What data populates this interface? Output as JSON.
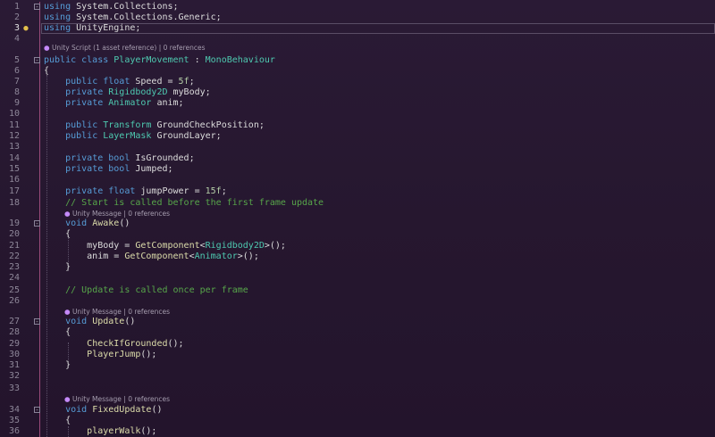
{
  "lens": {
    "unity_script": "Unity Script (1 asset reference) | 0 references",
    "unity_message": "Unity Message | 0 references"
  },
  "lines": [
    {
      "n": "1",
      "tokens": [
        [
          "kw",
          "using"
        ],
        [
          "ident",
          " System.Collections;"
        ]
      ]
    },
    {
      "n": "2",
      "tokens": [
        [
          "kw",
          "using"
        ],
        [
          "ident",
          " System.Collections.Generic;"
        ]
      ]
    },
    {
      "n": "3",
      "tokens": [
        [
          "kw",
          "using"
        ],
        [
          "ident",
          " UnityEngine;"
        ]
      ]
    },
    {
      "n": "4",
      "tokens": []
    },
    {
      "n": "5",
      "tokens": [
        [
          "kw",
          "public class "
        ],
        [
          "typ",
          "PlayerMovement"
        ],
        [
          "ident",
          " : "
        ],
        [
          "typ",
          "MonoBehaviour"
        ]
      ]
    },
    {
      "n": "6",
      "tokens": [
        [
          "ident",
          "{"
        ]
      ]
    },
    {
      "n": "7",
      "tokens": [
        [
          "ident",
          "    "
        ],
        [
          "kw",
          "public float "
        ],
        [
          "ident",
          "Speed = "
        ],
        [
          "num-lit",
          "5f"
        ],
        [
          "ident",
          ";"
        ]
      ]
    },
    {
      "n": "8",
      "tokens": [
        [
          "ident",
          "    "
        ],
        [
          "kw",
          "private "
        ],
        [
          "typ",
          "Rigidbody2D"
        ],
        [
          "ident",
          " myBody;"
        ]
      ]
    },
    {
      "n": "9",
      "tokens": [
        [
          "ident",
          "    "
        ],
        [
          "kw",
          "private "
        ],
        [
          "typ",
          "Animator"
        ],
        [
          "ident",
          " anim;"
        ]
      ]
    },
    {
      "n": "10",
      "tokens": []
    },
    {
      "n": "11",
      "tokens": [
        [
          "ident",
          "    "
        ],
        [
          "kw",
          "public "
        ],
        [
          "typ",
          "Transform"
        ],
        [
          "ident",
          " GroundCheckPosition;"
        ]
      ]
    },
    {
      "n": "12",
      "tokens": [
        [
          "ident",
          "    "
        ],
        [
          "kw",
          "public "
        ],
        [
          "typ",
          "LayerMask"
        ],
        [
          "ident",
          " GroundLayer;"
        ]
      ]
    },
    {
      "n": "13",
      "tokens": []
    },
    {
      "n": "14",
      "tokens": [
        [
          "ident",
          "    "
        ],
        [
          "kw",
          "private bool "
        ],
        [
          "ident",
          "IsGrounded;"
        ]
      ]
    },
    {
      "n": "15",
      "tokens": [
        [
          "ident",
          "    "
        ],
        [
          "kw",
          "private bool "
        ],
        [
          "ident",
          "Jumped;"
        ]
      ]
    },
    {
      "n": "16",
      "tokens": []
    },
    {
      "n": "17",
      "tokens": [
        [
          "ident",
          "    "
        ],
        [
          "kw",
          "private float "
        ],
        [
          "ident",
          "jumpPower = "
        ],
        [
          "num-lit",
          "15f"
        ],
        [
          "ident",
          ";"
        ]
      ]
    },
    {
      "n": "18",
      "tokens": [
        [
          "ident",
          "    "
        ],
        [
          "cmt",
          "// Start is called before the first frame update"
        ]
      ]
    },
    {
      "n": "19",
      "tokens": [
        [
          "ident",
          "    "
        ],
        [
          "kw",
          "void "
        ],
        [
          "method",
          "Awake"
        ],
        [
          "ident",
          "()"
        ]
      ]
    },
    {
      "n": "20",
      "tokens": [
        [
          "ident",
          "    {"
        ]
      ]
    },
    {
      "n": "21",
      "tokens": [
        [
          "ident",
          "        myBody = "
        ],
        [
          "method",
          "GetComponent"
        ],
        [
          "ident",
          "<"
        ],
        [
          "typ",
          "Rigidbody2D"
        ],
        [
          "ident",
          ">();"
        ]
      ]
    },
    {
      "n": "22",
      "tokens": [
        [
          "ident",
          "        anim = "
        ],
        [
          "method",
          "GetComponent"
        ],
        [
          "ident",
          "<"
        ],
        [
          "typ",
          "Animator"
        ],
        [
          "ident",
          ">();"
        ]
      ]
    },
    {
      "n": "23",
      "tokens": [
        [
          "ident",
          "    }"
        ]
      ]
    },
    {
      "n": "24",
      "tokens": []
    },
    {
      "n": "25",
      "tokens": [
        [
          "ident",
          "    "
        ],
        [
          "cmt",
          "// Update is called once per frame"
        ]
      ]
    },
    {
      "n": "26",
      "tokens": []
    },
    {
      "n": "27",
      "tokens": [
        [
          "ident",
          "    "
        ],
        [
          "kw",
          "void "
        ],
        [
          "method",
          "Update"
        ],
        [
          "ident",
          "()"
        ]
      ]
    },
    {
      "n": "28",
      "tokens": [
        [
          "ident",
          "    {"
        ]
      ]
    },
    {
      "n": "29",
      "tokens": [
        [
          "ident",
          "        "
        ],
        [
          "method",
          "CheckIfGrounded"
        ],
        [
          "ident",
          "();"
        ]
      ]
    },
    {
      "n": "30",
      "tokens": [
        [
          "ident",
          "        "
        ],
        [
          "method",
          "PlayerJump"
        ],
        [
          "ident",
          "();"
        ]
      ]
    },
    {
      "n": "31",
      "tokens": [
        [
          "ident",
          "    }"
        ]
      ]
    },
    {
      "n": "32",
      "tokens": []
    },
    {
      "n": "33",
      "tokens": []
    },
    {
      "n": "34",
      "tokens": [
        [
          "ident",
          "    "
        ],
        [
          "kw",
          "void "
        ],
        [
          "method",
          "FixedUpdate"
        ],
        [
          "ident",
          "()"
        ]
      ]
    },
    {
      "n": "35",
      "tokens": [
        [
          "ident",
          "    {"
        ]
      ]
    },
    {
      "n": "36",
      "tokens": [
        [
          "ident",
          "        "
        ],
        [
          "method",
          "playerWalk"
        ],
        [
          "ident",
          "();"
        ]
      ]
    }
  ],
  "colors": {
    "background": "#26172f",
    "keyword": "#569cd6",
    "type": "#4ec9b0",
    "comment": "#57a64a",
    "method": "#dcdcaa",
    "number": "#b5cea8"
  }
}
